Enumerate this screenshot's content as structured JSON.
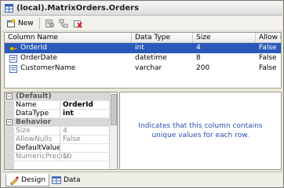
{
  "window": {
    "title": "(local).MatrixOrders.Orders"
  },
  "toolbar": {
    "new_label": "New"
  },
  "grid": {
    "columns": [
      "Column Name",
      "Data Type",
      "Size",
      "Allow N"
    ],
    "rows": [
      {
        "name": "OrderId",
        "type": "int",
        "size": "4",
        "allow": "False"
      },
      {
        "name": "OrderDate",
        "type": "datetime",
        "size": "8",
        "allow": "False"
      },
      {
        "name": "CustomerName",
        "type": "varchar",
        "size": "200",
        "allow": "False"
      }
    ]
  },
  "properties": {
    "cat_default": "(Default)",
    "name_label": "Name",
    "name_value": "OrderId",
    "datatype_label": "DataType",
    "datatype_value": "int",
    "cat_behavior": "Behavior",
    "size_label": "Size",
    "size_value": "4",
    "allownulls_label": "AllowNulls",
    "allownulls_value": "False",
    "defaultvalue_label": "DefaultValue",
    "defaultvalue_value": "",
    "numericprec_label": "NumericPrecisi",
    "numericprec_value": "10"
  },
  "description": {
    "text": "Indicates that this column contains unique values for each row."
  },
  "tabs": {
    "design": "Design",
    "data": "Data"
  }
}
